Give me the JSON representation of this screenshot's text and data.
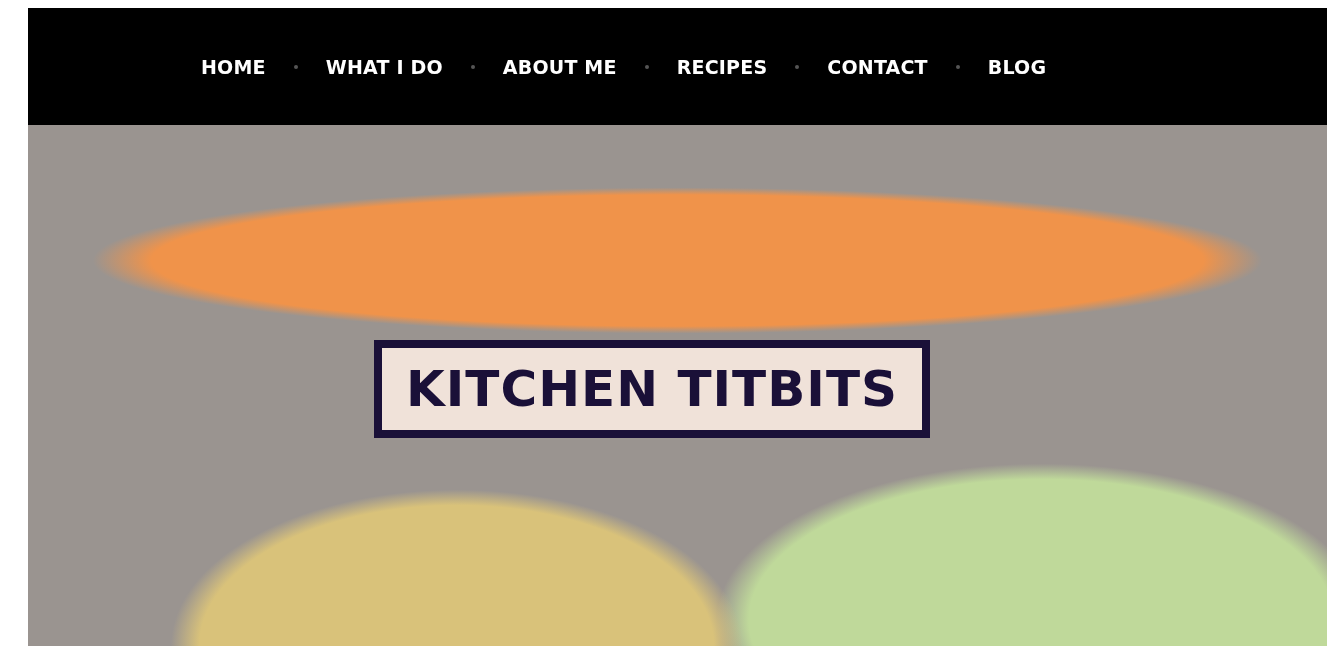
{
  "nav": {
    "items": [
      {
        "label": "HOME",
        "selected": false
      },
      {
        "label": "WHAT I DO",
        "selected": false
      },
      {
        "label": "ABOUT ME",
        "selected": false
      },
      {
        "label": "RECIPES",
        "selected": false
      },
      {
        "label": "CONTACT",
        "selected": false
      },
      {
        "label": "BLOG",
        "selected": false
      }
    ]
  },
  "hero": {
    "title": "KITCHEN TITBITS"
  }
}
